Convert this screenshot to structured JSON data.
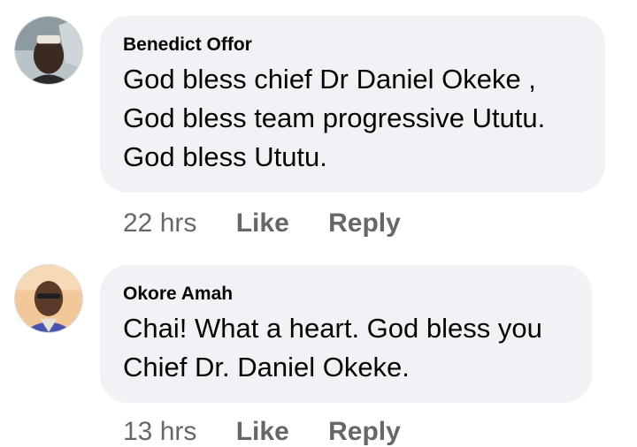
{
  "comments": [
    {
      "author": "Benedict Offor",
      "lines": [
        "God bless chief Dr Daniel Okeke ,",
        "God bless team progressive Ututu.",
        "God bless Ututu."
      ],
      "time": "22 hrs",
      "like_label": "Like",
      "reply_label": "Reply"
    },
    {
      "author": "Okore Amah",
      "lines": [
        "Chai! What a heart. God bless you",
        "Chief Dr. Daniel Okeke."
      ],
      "time": "13 hrs",
      "like_label": "Like",
      "reply_label": "Reply"
    }
  ],
  "colors": {
    "bubble_bg": "#f0f2f5",
    "meta_text": "#65676b",
    "body_text": "#050505"
  }
}
